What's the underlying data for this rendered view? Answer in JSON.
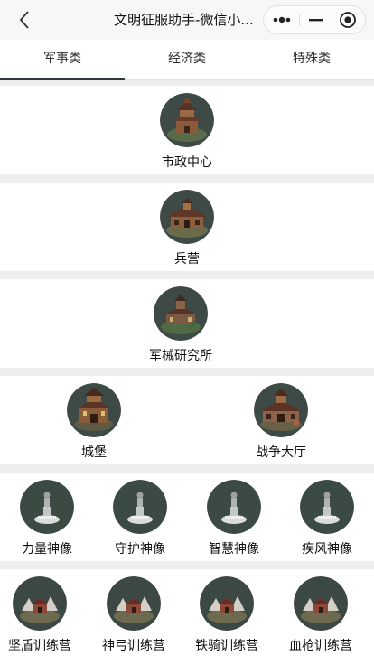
{
  "nav": {
    "title": "文明征服助手-微信小..."
  },
  "tabs": [
    {
      "label": "军事类",
      "active": true
    },
    {
      "label": "经济类",
      "active": false
    },
    {
      "label": "特殊类",
      "active": false
    }
  ],
  "sections": [
    {
      "buildings": [
        {
          "label": "市政中心",
          "icon": "city-hall-icon"
        }
      ]
    },
    {
      "buildings": [
        {
          "label": "兵营",
          "icon": "barracks-icon"
        }
      ]
    },
    {
      "buildings": [
        {
          "label": "军械研究所",
          "icon": "armory-icon"
        }
      ]
    },
    {
      "buildings": [
        {
          "label": "城堡",
          "icon": "castle-icon"
        },
        {
          "label": "战争大厅",
          "icon": "war-hall-icon"
        }
      ]
    },
    {
      "buildings": [
        {
          "label": "力量神像",
          "icon": "statue-icon"
        },
        {
          "label": "守护神像",
          "icon": "statue-icon"
        },
        {
          "label": "智慧神像",
          "icon": "statue-icon"
        },
        {
          "label": "疾风神像",
          "icon": "statue-icon"
        }
      ]
    },
    {
      "buildings": [
        {
          "label": "坚盾训练营",
          "icon": "training-camp-icon"
        },
        {
          "label": "神弓训练营",
          "icon": "training-camp-icon"
        },
        {
          "label": "铁骑训练营",
          "icon": "training-camp-icon"
        },
        {
          "label": "血枪训练营",
          "icon": "training-camp-icon"
        }
      ]
    }
  ],
  "colors": {
    "active_tab_underline": "#2e3a45",
    "icon_background": "#3e4a46",
    "page_background": "#eeeeee"
  }
}
